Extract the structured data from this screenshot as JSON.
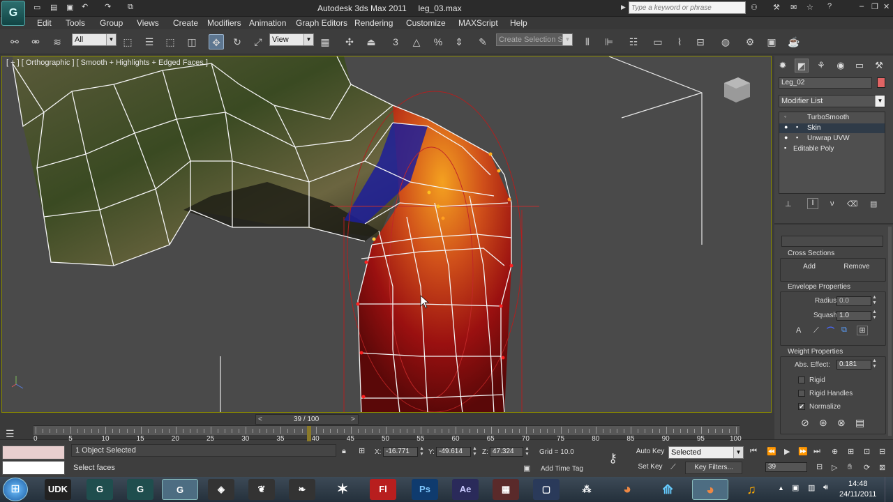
{
  "window": {
    "title": "Autodesk 3ds Max 2011",
    "filename": "leg_03.max",
    "search_placeholder": "Type a keyword or phrase"
  },
  "menu": [
    "Edit",
    "Tools",
    "Group",
    "Views",
    "Create",
    "Modifiers",
    "Animation",
    "Graph Editors",
    "Rendering",
    "Customize",
    "MAXScript",
    "Help"
  ],
  "toolbar": {
    "selection_filter": "All",
    "reference_coord": "View",
    "named_selection_placeholder": "Create Selection Se"
  },
  "viewport": {
    "label": "[ + ] [ Orthographic ] [ Smooth + Highlights + Edged Faces ]"
  },
  "command_panel": {
    "object_name": "Leg_02",
    "modifier_list_label": "Modifier List",
    "stack": [
      {
        "label": "TurboSmooth",
        "selected": false
      },
      {
        "label": "Skin",
        "selected": true
      },
      {
        "label": "Unwrap UVW",
        "selected": false
      },
      {
        "label": "Editable Poly",
        "selected": false
      }
    ],
    "cross_sections": {
      "title": "Cross Sections",
      "add": "Add",
      "remove": "Remove"
    },
    "envelope": {
      "title": "Envelope Properties",
      "radius_label": "Radius:",
      "radius_value": "0.0",
      "squash_label": "Squash:",
      "squash_value": "1.0"
    },
    "weight": {
      "title": "Weight Properties",
      "abs_effect_label": "Abs. Effect:",
      "abs_effect_value": "0.181",
      "rigid": "Rigid",
      "rigid_handles": "Rigid Handles",
      "normalize": "Normalize",
      "normalize_checked": true
    }
  },
  "timeline": {
    "frame_display": "39 / 100",
    "current_frame": 39,
    "total_frames": 100,
    "ticks": [
      "0",
      "5",
      "10",
      "15",
      "20",
      "25",
      "30",
      "35",
      "40",
      "45",
      "50",
      "55",
      "60",
      "65",
      "70",
      "75",
      "80",
      "85",
      "90",
      "95",
      "100"
    ]
  },
  "status": {
    "objects": "1 Object Selected",
    "prompt": "Select faces",
    "x_label": "X:",
    "x": "-16.771",
    "y_label": "Y:",
    "y": "-49.614",
    "z_label": "Z:",
    "z": "47.324",
    "grid": "Grid = 10.0",
    "add_time_tag": "Add Time Tag",
    "auto_key": "Auto Key",
    "set_key": "Set Key",
    "key_mode": "Selected",
    "key_filters": "Key Filters...",
    "frame": "39"
  },
  "taskbar": {
    "apps": [
      "UDK",
      "Fl",
      "Ps",
      "Ae"
    ],
    "time": "14:48",
    "date": "24/11/2011"
  }
}
